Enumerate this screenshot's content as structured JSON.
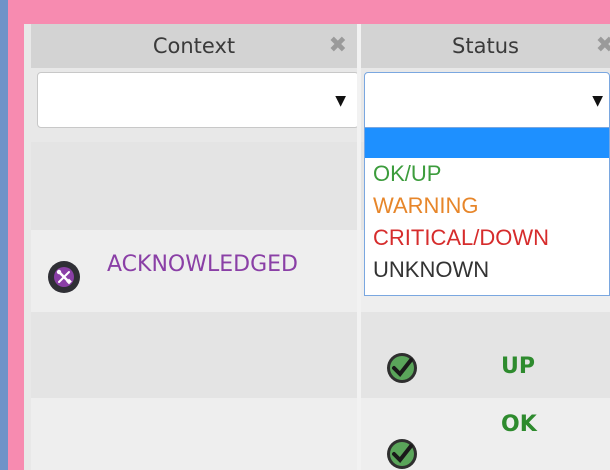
{
  "columns": [
    {
      "label": "Context",
      "close": "✖"
    },
    {
      "label": "Status",
      "close": "✖"
    }
  ],
  "filters": {
    "context": {
      "value": "",
      "arrow": "▼"
    },
    "status": {
      "value": "",
      "arrow": "▼"
    }
  },
  "status_options": [
    {
      "label": "",
      "color": "#000000"
    },
    {
      "label": "OK/UP",
      "color": "#3c9c3c"
    },
    {
      "label": "WARNING",
      "color": "#e7862a"
    },
    {
      "label": "CRITICAL/DOWN",
      "color": "#d62c2c"
    },
    {
      "label": "UNKNOWN",
      "color": "#333333"
    }
  ],
  "rows": [
    {
      "context": "",
      "status": ""
    },
    {
      "context": "ACKNOWLEDGED",
      "context_icon": "tools-icon",
      "status": ""
    },
    {
      "context": "",
      "status": "UP",
      "status_icon": "check-icon"
    },
    {
      "context": "",
      "status": "OK",
      "status_icon": "check-icon"
    }
  ],
  "colors": {
    "acknowledged": "#8a3fa6",
    "ok": "#2e8b2e",
    "selected": "#1e90ff"
  }
}
